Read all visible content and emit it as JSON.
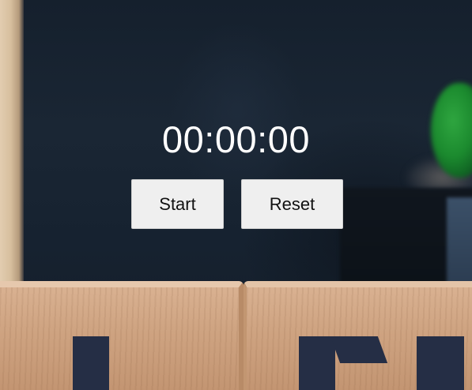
{
  "timer": {
    "display": "00:00:00"
  },
  "controls": {
    "start_label": "Start",
    "reset_label": "Reset"
  },
  "colors": {
    "background": "#172230",
    "text": "#ffffff",
    "button_bg": "#efefef",
    "button_text": "#111111"
  }
}
